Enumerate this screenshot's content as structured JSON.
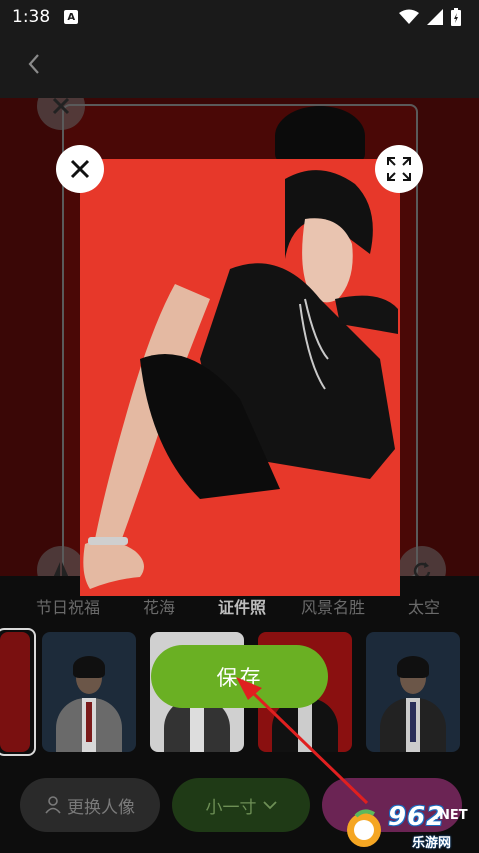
{
  "status_bar": {
    "time": "1:38",
    "notification_badge": "A"
  },
  "header": {
    "back_icon": "chevron-left-icon"
  },
  "categories": {
    "tabs": [
      {
        "label": "节日祝福",
        "active": false
      },
      {
        "label": "花海",
        "active": false
      },
      {
        "label": "证件照",
        "active": true
      },
      {
        "label": "风景名胜",
        "active": false
      },
      {
        "label": "太空",
        "active": false
      }
    ]
  },
  "actions": {
    "change_portrait_label": "更换人像",
    "size_label": "小一寸",
    "third_label": ""
  },
  "preview_modal": {
    "close_icon": "close-icon",
    "expand_icon": "fullscreen-icon",
    "save_label": "保存",
    "background_color": "#e7382a"
  },
  "watermark": {
    "number": "962",
    "suffix": ".NET",
    "site": "乐游网"
  },
  "colors": {
    "save_green": "#6ab023",
    "annotation_arrow": "#e02020"
  }
}
